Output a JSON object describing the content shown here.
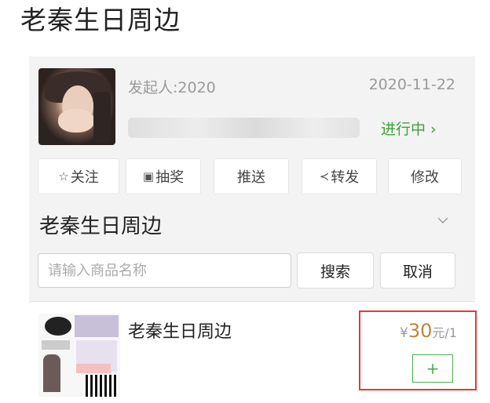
{
  "page": {
    "title": "老秦生日周边"
  },
  "event": {
    "initiator": "发起人:2020",
    "date": "2020-11-22",
    "status": "进行中 ›"
  },
  "actions": [
    {
      "icon": "☆",
      "label": "关注"
    },
    {
      "icon": "▣",
      "label": "抽奖"
    },
    {
      "icon": "",
      "label": "推送"
    },
    {
      "icon": "≺",
      "label": "转发"
    },
    {
      "icon": "",
      "label": "修改"
    }
  ],
  "section": {
    "title": "老秦生日周边"
  },
  "search": {
    "placeholder": "请输入商品名称",
    "search_label": "搜索",
    "cancel_label": "取消"
  },
  "product": {
    "name": "老秦生日周边",
    "price_currency": "¥",
    "price_value": "30",
    "price_unit": "元/1",
    "add_label": "+"
  },
  "colors": {
    "accent_green": "#3aa336",
    "price": "#c0843a",
    "highlight": "#e53935"
  }
}
